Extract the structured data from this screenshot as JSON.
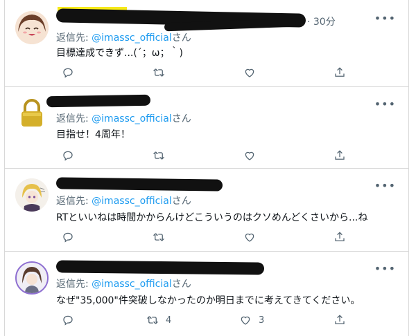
{
  "replies": [
    {
      "reply_prefix": "返信先:",
      "handle": "@imassc_official",
      "suffix": "さん",
      "text": "目標達成できず...(´；ω；｀)",
      "time": "· 30分",
      "reply_count": "",
      "retweet_count": "",
      "like_count": ""
    },
    {
      "reply_prefix": "返信先:",
      "handle": "@imassc_official",
      "suffix": "さん",
      "text": "目指せ！4周年！",
      "time": "",
      "reply_count": "",
      "retweet_count": "",
      "like_count": ""
    },
    {
      "reply_prefix": "返信先:",
      "handle": "@imassc_official",
      "suffix": "さん",
      "text": "RTといいねは時間かからんけどこういうのはクソめんどくさいから...ね",
      "time": "",
      "reply_count": "",
      "retweet_count": "",
      "like_count": ""
    },
    {
      "reply_prefix": "返信先:",
      "handle": "@imassc_official",
      "suffix": "さん",
      "text": "なぜ\"35,000\"件突破しなかったのか明日までに考えてきてください。",
      "time": "",
      "reply_count": "",
      "retweet_count": "4",
      "like_count": "3"
    }
  ],
  "icons": {
    "more": "more-dots-icon",
    "reply": "reply-icon",
    "retweet": "retweet-icon",
    "like": "heart-icon",
    "share": "share-icon"
  },
  "colors": {
    "link": "#1d9bf0",
    "secondary": "#536471",
    "highlight": "#f7ea1a"
  }
}
